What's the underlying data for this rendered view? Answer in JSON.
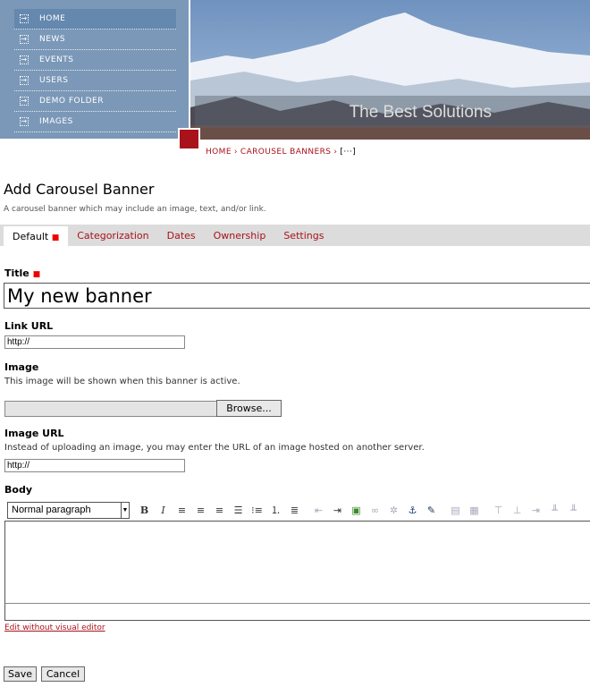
{
  "nav": {
    "items": [
      {
        "label": "HOME",
        "active": true
      },
      {
        "label": "NEWS"
      },
      {
        "label": "EVENTS"
      },
      {
        "label": "USERS"
      },
      {
        "label": "DEMO FOLDER"
      },
      {
        "label": "IMAGES"
      }
    ]
  },
  "banner": {
    "caption": "The Best Solutions"
  },
  "breadcrumb": {
    "home": "HOME",
    "section": "CAROUSEL BANNERS",
    "current": "[···]",
    "sep": "›"
  },
  "page": {
    "title": "Add Carousel Banner",
    "description": "A carousel banner which may include an image, text, and/or link."
  },
  "tabs": [
    {
      "label": "Default",
      "active": true
    },
    {
      "label": "Categorization"
    },
    {
      "label": "Dates"
    },
    {
      "label": "Ownership"
    },
    {
      "label": "Settings"
    }
  ],
  "form": {
    "required_mark": "■",
    "title_label": "Title",
    "title_value": "My new banner",
    "link_label": "Link URL",
    "link_value": "http://",
    "image_label": "Image",
    "image_help": "This image will be shown when this banner is active.",
    "browse_label": "Browse...",
    "image_url_label": "Image URL",
    "image_url_help": "Instead of uploading an image, you may enter the URL of an image hosted on another server.",
    "image_url_value": "http://",
    "body_label": "Body",
    "format_value": "Normal paragraph",
    "edit_link": "Edit without visual editor",
    "save_label": "Save",
    "cancel_label": "Cancel"
  },
  "toolbar_icons": [
    "bold",
    "italic",
    "align-left",
    "align-center",
    "align-right",
    "align-justify",
    "bullet-list",
    "numbered-list",
    "definition-list",
    "outdent",
    "indent",
    "image",
    "link",
    "unlink",
    "anchor",
    "edit-html",
    "table",
    "table-props",
    "row-before",
    "row-after",
    "row-delete",
    "col-before",
    "col-after"
  ],
  "colors": {
    "accent": "#a8121b",
    "nav_bg": "#7b98b8",
    "nav_active": "#6488ae"
  }
}
